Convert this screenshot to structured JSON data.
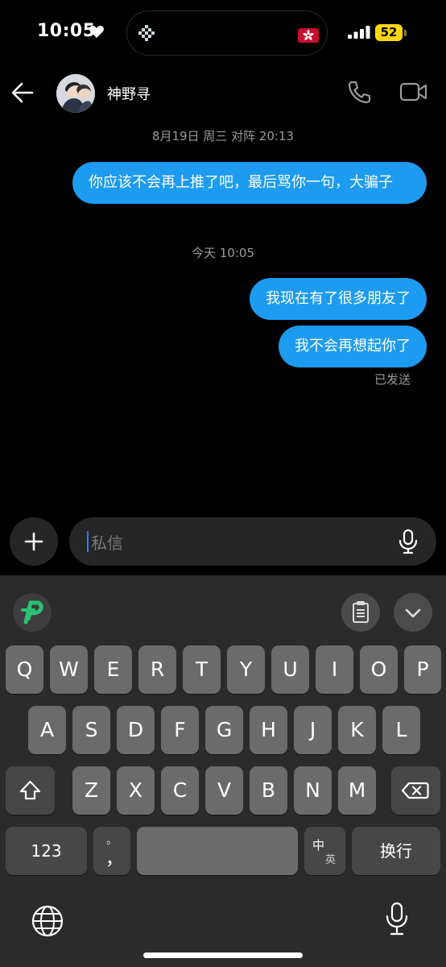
{
  "status_bar": {
    "time": "10:05",
    "battery": "52"
  },
  "header": {
    "contact_name": "神野寻"
  },
  "messages": [
    {
      "timestamp": "8月19日 周三 对阵 20:13",
      "text": "你应该不会再上推了吧，最后骂你一句，大骗子"
    },
    {
      "timestamp": "今天 10:05",
      "text": "我现在有了很多朋友了"
    },
    {
      "text": "我不会再想起你了",
      "status": "已发送"
    }
  ],
  "composer": {
    "placeholder": "私信"
  },
  "keyboard": {
    "row1": [
      "Q",
      "W",
      "E",
      "R",
      "T",
      "Y",
      "U",
      "I",
      "O",
      "P"
    ],
    "row2": [
      "A",
      "S",
      "D",
      "F",
      "G",
      "H",
      "J",
      "K",
      "L"
    ],
    "row3": [
      "Z",
      "X",
      "C",
      "V",
      "B",
      "N",
      "M"
    ],
    "numbers_key": "123",
    "punct_top": "。",
    "punct_bottom": "，",
    "lang_top": "中",
    "lang_bottom": "英",
    "return_key": "换行"
  },
  "colors": {
    "bubble": "#1d9bf0",
    "background": "#000000",
    "battery": "#ffd60a"
  }
}
